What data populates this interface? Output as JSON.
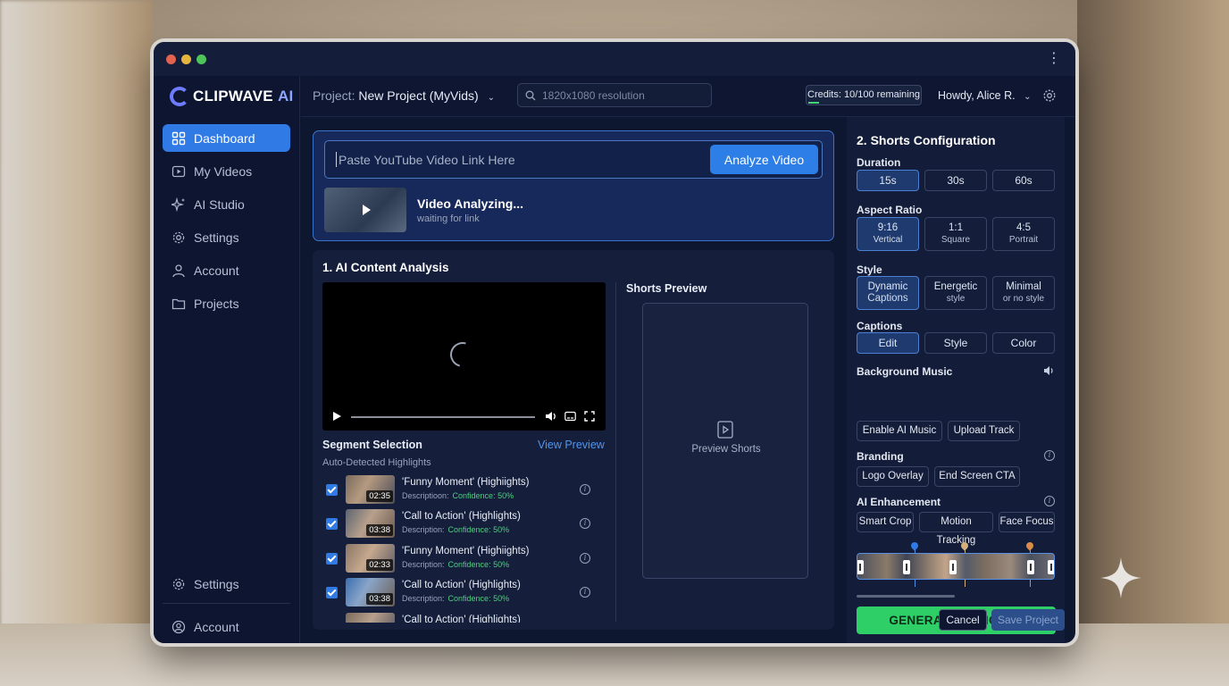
{
  "app": {
    "brand": "CLIPWAVE",
    "brand_suffix": "AI"
  },
  "window_controls": {
    "colors": [
      "#e0624f",
      "#e6b53e",
      "#4ec55a"
    ]
  },
  "sidebar": {
    "items": [
      {
        "label": "Dashboard",
        "icon": "grid-icon",
        "active": true
      },
      {
        "label": "My Videos",
        "icon": "video-icon"
      },
      {
        "label": "AI Studio",
        "icon": "sparkles-icon"
      },
      {
        "label": "Settings",
        "icon": "gear-icon"
      },
      {
        "label": "Account",
        "icon": "user-icon"
      },
      {
        "label": "Projects",
        "icon": "folder-icon"
      }
    ],
    "bottom_items": [
      {
        "label": "Settings",
        "icon": "gear-icon"
      },
      {
        "label": "Account",
        "icon": "user-circle-icon"
      }
    ]
  },
  "topbar": {
    "project_prefix": "Project:",
    "project_name": "New Project (MyVids)",
    "search_placeholder": "1820x1080 resolution",
    "credits": "Credits: 10/100 remaining",
    "credits_fraction": 0.1,
    "user": "Howdy, Alice R."
  },
  "url_panel": {
    "placeholder": "Paste YouTube Video Link Here",
    "analyze_label": "Analyze Video",
    "status_title": "Video Analyzing...",
    "status_sub": "waiting for link"
  },
  "analysis": {
    "title": "1. AI Content Analysis",
    "shorts_preview_label": "Shorts Preview",
    "shorts_preview_text": "Preview Shorts",
    "segment_title": "Segment Selection",
    "view_preview": "View Preview",
    "segment_sub": "Auto-Detected Highlights",
    "segments": [
      {
        "time": "02:35",
        "name": "'Funny Moment' (Highiights)",
        "desc": "Descriptioon:",
        "conf": "Confidence: 50%"
      },
      {
        "time": "03:38",
        "name": "'Call to Action' (Highlights)",
        "desc": "Description:",
        "conf": "Confidence: 50%"
      },
      {
        "time": "02:33",
        "name": "'Funny Moment' (Highiights)",
        "desc": "Description:",
        "conf": "Confidence: 50%"
      },
      {
        "time": "03:38",
        "name": "'Call to Action' (Highlights)",
        "desc": "Description:",
        "conf": "Confidence: 50%"
      },
      {
        "time": "",
        "name": "'Call to Action' (Highlights)",
        "desc": "",
        "conf": ""
      }
    ]
  },
  "config": {
    "title": "2. Shorts Configuration",
    "duration_label": "Duration",
    "durations": [
      "15s",
      "30s",
      "60s"
    ],
    "aspect_label": "Aspect Ratio",
    "aspects": [
      {
        "main": "9:16",
        "sub": "Vertical"
      },
      {
        "main": "1:1",
        "sub": "Square"
      },
      {
        "main": "4:5",
        "sub": "Portrait"
      }
    ],
    "style_label": "Style",
    "styles": [
      {
        "main": "Dynamic",
        "sub": "Captions"
      },
      {
        "main": "Energetic",
        "sub": "style"
      },
      {
        "main": "Minimal",
        "sub": "or no style"
      }
    ],
    "captions_label": "Captions",
    "captions": [
      "Edit",
      "Style",
      "Color"
    ],
    "music_label": "Background Music",
    "music": [
      "Enable AI Music",
      "Upload Track"
    ],
    "branding_label": "Branding",
    "branding": [
      "Logo Overlay",
      "End Screen CTA"
    ],
    "enhance_label": "AI Enhancement",
    "enhance": [
      "Smart Crop",
      "Motion Tracking",
      "Face Focus"
    ],
    "generate_label": "GENERATE 9 SHORTS"
  },
  "footer": {
    "cancel": "Cancel",
    "save": "Save Project"
  }
}
